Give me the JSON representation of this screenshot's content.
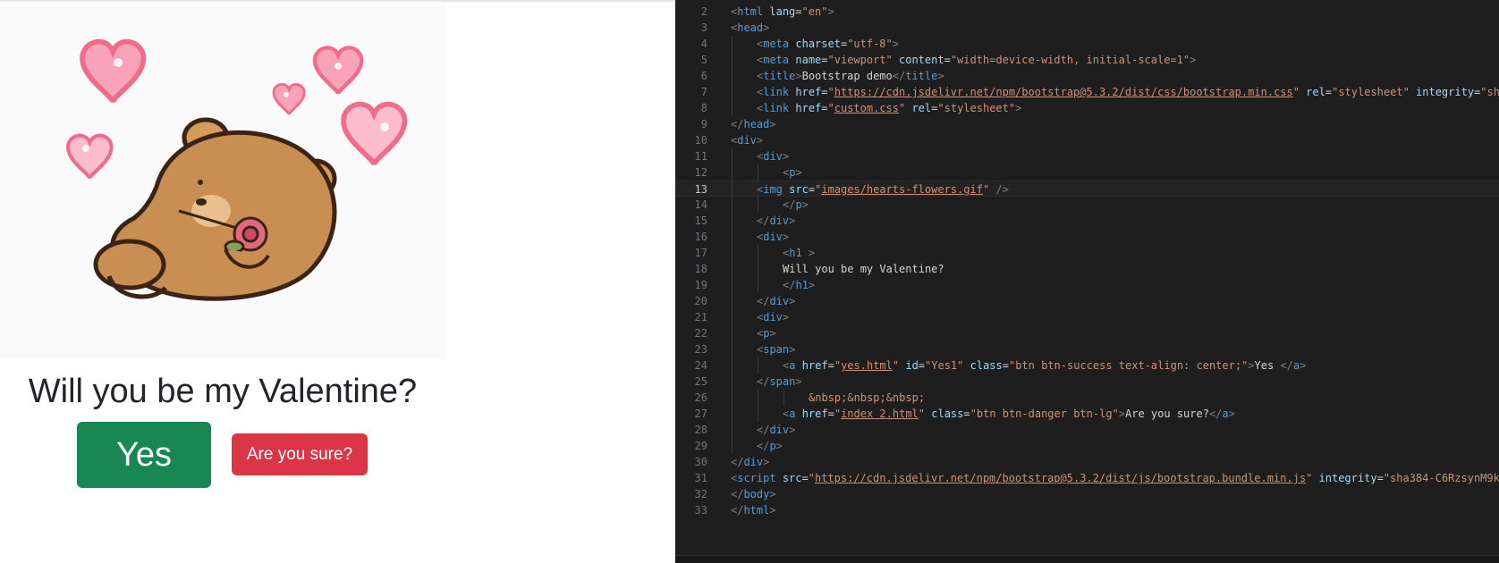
{
  "preview": {
    "image_alt": "bear holding rose with hearts",
    "heading": "Will you be my Valentine?",
    "yes_label": "Yes",
    "sure_label": "Are you sure?"
  },
  "colors": {
    "success": "#198754",
    "danger": "#dc3545",
    "editor_bg": "#1e1e1e"
  },
  "editor": {
    "current_line": "13",
    "lines": [
      {
        "n": "2",
        "indent": 0,
        "tokens": [
          [
            "p",
            "<"
          ],
          [
            "t",
            "html"
          ],
          [
            "x",
            " "
          ],
          [
            "a",
            "lang"
          ],
          [
            "x",
            "="
          ],
          [
            "s",
            "\"en\""
          ],
          [
            "p",
            ">"
          ]
        ]
      },
      {
        "n": "3",
        "indent": 0,
        "tokens": [
          [
            "p",
            "<"
          ],
          [
            "t",
            "head"
          ],
          [
            "p",
            ">"
          ]
        ]
      },
      {
        "n": "4",
        "indent": 1,
        "tokens": [
          [
            "p",
            "<"
          ],
          [
            "t",
            "meta"
          ],
          [
            "x",
            " "
          ],
          [
            "a",
            "charset"
          ],
          [
            "x",
            "="
          ],
          [
            "s",
            "\"utf-8\""
          ],
          [
            "p",
            ">"
          ]
        ]
      },
      {
        "n": "5",
        "indent": 1,
        "tokens": [
          [
            "p",
            "<"
          ],
          [
            "t",
            "meta"
          ],
          [
            "x",
            " "
          ],
          [
            "a",
            "name"
          ],
          [
            "x",
            "="
          ],
          [
            "s",
            "\"viewport\""
          ],
          [
            "x",
            " "
          ],
          [
            "a",
            "content"
          ],
          [
            "x",
            "="
          ],
          [
            "s",
            "\"width=device-width, initial-scale=1\""
          ],
          [
            "p",
            ">"
          ]
        ]
      },
      {
        "n": "6",
        "indent": 1,
        "tokens": [
          [
            "p",
            "<"
          ],
          [
            "t",
            "title"
          ],
          [
            "p",
            ">"
          ],
          [
            "x",
            "Bootstrap demo"
          ],
          [
            "p",
            "</"
          ],
          [
            "t",
            "title"
          ],
          [
            "p",
            ">"
          ]
        ]
      },
      {
        "n": "7",
        "indent": 1,
        "tokens": [
          [
            "p",
            "<"
          ],
          [
            "t",
            "link"
          ],
          [
            "x",
            " "
          ],
          [
            "a",
            "href"
          ],
          [
            "x",
            "="
          ],
          [
            "s",
            "\""
          ],
          [
            "u",
            "https://cdn.jsdelivr.net/npm/bootstrap@5.3.2/dist/css/bootstrap.min.css"
          ],
          [
            "s",
            "\""
          ],
          [
            "x",
            " "
          ],
          [
            "a",
            "rel"
          ],
          [
            "x",
            "="
          ],
          [
            "s",
            "\"stylesheet\""
          ],
          [
            "x",
            " "
          ],
          [
            "a",
            "integrity"
          ],
          [
            "x",
            "="
          ],
          [
            "s",
            "\"sh"
          ]
        ]
      },
      {
        "n": "8",
        "indent": 1,
        "tokens": [
          [
            "p",
            "<"
          ],
          [
            "t",
            "link"
          ],
          [
            "x",
            " "
          ],
          [
            "a",
            "href"
          ],
          [
            "x",
            "="
          ],
          [
            "s",
            "\""
          ],
          [
            "u",
            "custom.css"
          ],
          [
            "s",
            "\""
          ],
          [
            "x",
            " "
          ],
          [
            "a",
            "rel"
          ],
          [
            "x",
            "="
          ],
          [
            "s",
            "\"stylesheet\""
          ],
          [
            "p",
            ">"
          ]
        ]
      },
      {
        "n": "9",
        "indent": 0,
        "tokens": [
          [
            "p",
            "</"
          ],
          [
            "t",
            "head"
          ],
          [
            "p",
            ">"
          ]
        ]
      },
      {
        "n": "10",
        "indent": 0,
        "tokens": [
          [
            "p",
            "<"
          ],
          [
            "t",
            "div"
          ],
          [
            "p",
            ">"
          ]
        ]
      },
      {
        "n": "11",
        "indent": 1,
        "tokens": [
          [
            "p",
            "<"
          ],
          [
            "t",
            "div"
          ],
          [
            "p",
            ">"
          ]
        ]
      },
      {
        "n": "12",
        "indent": 2,
        "tokens": [
          [
            "p",
            "<"
          ],
          [
            "t",
            "p"
          ],
          [
            "p",
            ">"
          ]
        ]
      },
      {
        "n": "13",
        "indent": 1,
        "tokens": [
          [
            "p",
            "<"
          ],
          [
            "t",
            "img"
          ],
          [
            "x",
            " "
          ],
          [
            "a",
            "src"
          ],
          [
            "x",
            "="
          ],
          [
            "s",
            "\""
          ],
          [
            "u",
            "images/hearts-flowers.gif"
          ],
          [
            "s",
            "\""
          ],
          [
            "x",
            " "
          ],
          [
            "p",
            "/>"
          ]
        ]
      },
      {
        "n": "14",
        "indent": 2,
        "tokens": [
          [
            "p",
            "</"
          ],
          [
            "t",
            "p"
          ],
          [
            "p",
            ">"
          ]
        ]
      },
      {
        "n": "15",
        "indent": 1,
        "tokens": [
          [
            "p",
            "</"
          ],
          [
            "t",
            "div"
          ],
          [
            "p",
            ">"
          ]
        ]
      },
      {
        "n": "16",
        "indent": 1,
        "tokens": [
          [
            "p",
            "<"
          ],
          [
            "t",
            "div"
          ],
          [
            "p",
            ">"
          ]
        ]
      },
      {
        "n": "17",
        "indent": 2,
        "tokens": [
          [
            "p",
            "<"
          ],
          [
            "t",
            "h1"
          ],
          [
            "x",
            " "
          ],
          [
            "p",
            ">"
          ]
        ]
      },
      {
        "n": "18",
        "indent": 2,
        "tokens": [
          [
            "x",
            "Will you be my Valentine?"
          ]
        ]
      },
      {
        "n": "19",
        "indent": 2,
        "tokens": [
          [
            "p",
            "</"
          ],
          [
            "t",
            "h1"
          ],
          [
            "p",
            ">"
          ]
        ]
      },
      {
        "n": "20",
        "indent": 1,
        "tokens": [
          [
            "p",
            "</"
          ],
          [
            "t",
            "div"
          ],
          [
            "p",
            ">"
          ]
        ]
      },
      {
        "n": "21",
        "indent": 1,
        "tokens": [
          [
            "p",
            "<"
          ],
          [
            "t",
            "div"
          ],
          [
            "p",
            ">"
          ]
        ]
      },
      {
        "n": "22",
        "indent": 1,
        "tokens": [
          [
            "p",
            "<"
          ],
          [
            "t",
            "p"
          ],
          [
            "p",
            ">"
          ]
        ]
      },
      {
        "n": "23",
        "indent": 1,
        "tokens": [
          [
            "p",
            "<"
          ],
          [
            "t",
            "span"
          ],
          [
            "p",
            ">"
          ]
        ]
      },
      {
        "n": "24",
        "indent": 2,
        "tokens": [
          [
            "p",
            "<"
          ],
          [
            "t",
            "a"
          ],
          [
            "x",
            " "
          ],
          [
            "a",
            "href"
          ],
          [
            "x",
            "="
          ],
          [
            "s",
            "\""
          ],
          [
            "u",
            "yes.html"
          ],
          [
            "s",
            "\""
          ],
          [
            "x",
            " "
          ],
          [
            "a",
            "id"
          ],
          [
            "x",
            "="
          ],
          [
            "s",
            "\"Yes1\""
          ],
          [
            "x",
            " "
          ],
          [
            "a",
            "class"
          ],
          [
            "x",
            "="
          ],
          [
            "s",
            "\"btn btn-success text-align: center;\""
          ],
          [
            "p",
            ">"
          ],
          [
            "x",
            "Yes "
          ],
          [
            "p",
            "</"
          ],
          [
            "t",
            "a"
          ],
          [
            "p",
            ">"
          ]
        ]
      },
      {
        "n": "25",
        "indent": 1,
        "tokens": [
          [
            "p",
            "</"
          ],
          [
            "t",
            "span"
          ],
          [
            "p",
            ">"
          ]
        ]
      },
      {
        "n": "26",
        "indent": 3,
        "tokens": [
          [
            "s",
            "&nbsp;&nbsp;&nbsp;"
          ]
        ]
      },
      {
        "n": "27",
        "indent": 2,
        "tokens": [
          [
            "p",
            "<"
          ],
          [
            "t",
            "a"
          ],
          [
            "x",
            " "
          ],
          [
            "a",
            "href"
          ],
          [
            "x",
            "="
          ],
          [
            "s",
            "\""
          ],
          [
            "u",
            "index 2.html"
          ],
          [
            "s",
            "\""
          ],
          [
            "x",
            " "
          ],
          [
            "a",
            "class"
          ],
          [
            "x",
            "="
          ],
          [
            "s",
            "\"btn btn-danger btn-lg\""
          ],
          [
            "p",
            ">"
          ],
          [
            "x",
            "Are you sure?"
          ],
          [
            "p",
            "</"
          ],
          [
            "t",
            "a"
          ],
          [
            "p",
            ">"
          ]
        ]
      },
      {
        "n": "28",
        "indent": 1,
        "tokens": [
          [
            "p",
            "</"
          ],
          [
            "t",
            "div"
          ],
          [
            "p",
            ">"
          ]
        ]
      },
      {
        "n": "29",
        "indent": 1,
        "tokens": [
          [
            "p",
            "</"
          ],
          [
            "t",
            "p"
          ],
          [
            "p",
            ">"
          ]
        ]
      },
      {
        "n": "30",
        "indent": 0,
        "tokens": [
          [
            "p",
            "</"
          ],
          [
            "t",
            "div"
          ],
          [
            "p",
            ">"
          ]
        ]
      },
      {
        "n": "31",
        "indent": 0,
        "tokens": [
          [
            "p",
            "<"
          ],
          [
            "t",
            "script"
          ],
          [
            "x",
            " "
          ],
          [
            "a",
            "src"
          ],
          [
            "x",
            "="
          ],
          [
            "s",
            "\""
          ],
          [
            "u",
            "https://cdn.jsdelivr.net/npm/bootstrap@5.3.2/dist/js/bootstrap.bundle.min.js"
          ],
          [
            "s",
            "\""
          ],
          [
            "x",
            " "
          ],
          [
            "a",
            "integrity"
          ],
          [
            "x",
            "="
          ],
          [
            "s",
            "\"sha384-C6RzsynM9k"
          ]
        ]
      },
      {
        "n": "32",
        "indent": 0,
        "tokens": [
          [
            "p",
            "</"
          ],
          [
            "t",
            "body"
          ],
          [
            "p",
            ">"
          ]
        ]
      },
      {
        "n": "33",
        "indent": 0,
        "tokens": [
          [
            "p",
            "</"
          ],
          [
            "t",
            "html"
          ],
          [
            "p",
            ">"
          ]
        ]
      }
    ]
  }
}
